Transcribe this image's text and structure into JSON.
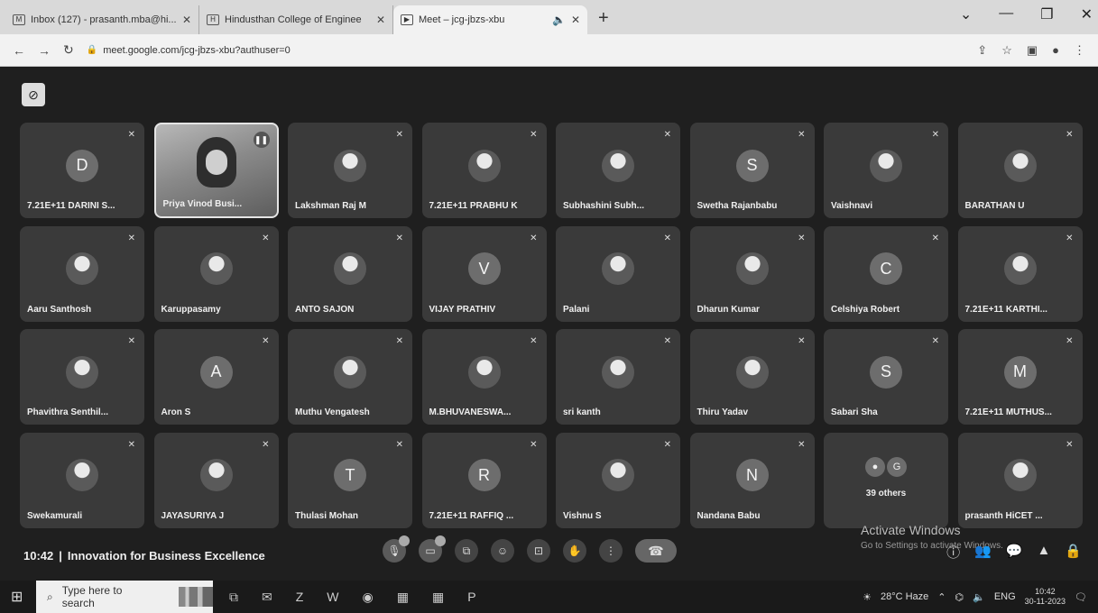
{
  "browser": {
    "tabs": [
      {
        "title": "Inbox (127) - prasanth.mba@hi...",
        "icon": "gmail-icon",
        "active": false
      },
      {
        "title": "Hindusthan College of Enginee",
        "icon": "college-icon",
        "active": false
      },
      {
        "title": "Meet – jcg-jbzs-xbu",
        "icon": "meet-icon",
        "active": true
      }
    ],
    "new_tab": "+",
    "url": "meet.google.com/jcg-jbzs-xbu?authuser=0"
  },
  "participants": [
    {
      "name": "7.21E+11 DARINI S...",
      "initial": "D",
      "type": "letter"
    },
    {
      "name": "Priya Vinod Busi...",
      "initial": "",
      "type": "video"
    },
    {
      "name": "Lakshman Raj M",
      "initial": "",
      "type": "photo"
    },
    {
      "name": "7.21E+11 PRABHU K",
      "initial": "",
      "type": "photo"
    },
    {
      "name": "Subhashini Subh...",
      "initial": "",
      "type": "photo"
    },
    {
      "name": "Swetha Rajanbabu",
      "initial": "S",
      "type": "letter"
    },
    {
      "name": "Vaishnavi",
      "initial": "",
      "type": "photo"
    },
    {
      "name": "BARATHAN U",
      "initial": "",
      "type": "photo"
    },
    {
      "name": "Aaru Santhosh",
      "initial": "",
      "type": "photo"
    },
    {
      "name": "Karuppasamy",
      "initial": "",
      "type": "photo"
    },
    {
      "name": "ANTO SAJON",
      "initial": "",
      "type": "photo"
    },
    {
      "name": "VIJAY PRATHIV",
      "initial": "V",
      "type": "letter"
    },
    {
      "name": "Palani",
      "initial": "",
      "type": "photo"
    },
    {
      "name": "Dharun Kumar",
      "initial": "",
      "type": "photo"
    },
    {
      "name": "Celshiya Robert",
      "initial": "C",
      "type": "letter"
    },
    {
      "name": "7.21E+11 KARTHI...",
      "initial": "",
      "type": "photo"
    },
    {
      "name": "Phavithra Senthil...",
      "initial": "",
      "type": "photo"
    },
    {
      "name": "Aron S",
      "initial": "A",
      "type": "letter"
    },
    {
      "name": "Muthu Vengatesh",
      "initial": "",
      "type": "photo"
    },
    {
      "name": "M.BHUVANESWA...",
      "initial": "",
      "type": "photo"
    },
    {
      "name": "sri kanth",
      "initial": "",
      "type": "photo"
    },
    {
      "name": "Thiru Yadav",
      "initial": "",
      "type": "photo"
    },
    {
      "name": "Sabari Sha",
      "initial": "S",
      "type": "letter"
    },
    {
      "name": "7.21E+11 MUTHUS...",
      "initial": "M",
      "type": "letter"
    },
    {
      "name": "Swekamurali",
      "initial": "",
      "type": "photo"
    },
    {
      "name": "JAYASURIYA J",
      "initial": "",
      "type": "photo"
    },
    {
      "name": "Thulasi Mohan",
      "initial": "T",
      "type": "letter"
    },
    {
      "name": "7.21E+11 RAFFIQ ...",
      "initial": "R",
      "type": "letter"
    },
    {
      "name": "Vishnu S",
      "initial": "",
      "type": "photo"
    },
    {
      "name": "Nandana Babu",
      "initial": "N",
      "type": "letter"
    },
    {
      "name": "39 others",
      "initial": "G",
      "type": "others"
    },
    {
      "name": "prasanth HiCET ...",
      "initial": "",
      "type": "photo"
    }
  ],
  "meeting": {
    "time": "10:42",
    "separator": "|",
    "title": "Innovation for Business Excellence"
  },
  "watermark": {
    "line1": "Activate Windows",
    "line2": "Go to Settings to activate Windows."
  },
  "taskbar": {
    "search_placeholder": "Type here to search",
    "weather": "28°C Haze",
    "language": "ENG",
    "time": "10:42",
    "date": "30-11-2023"
  }
}
